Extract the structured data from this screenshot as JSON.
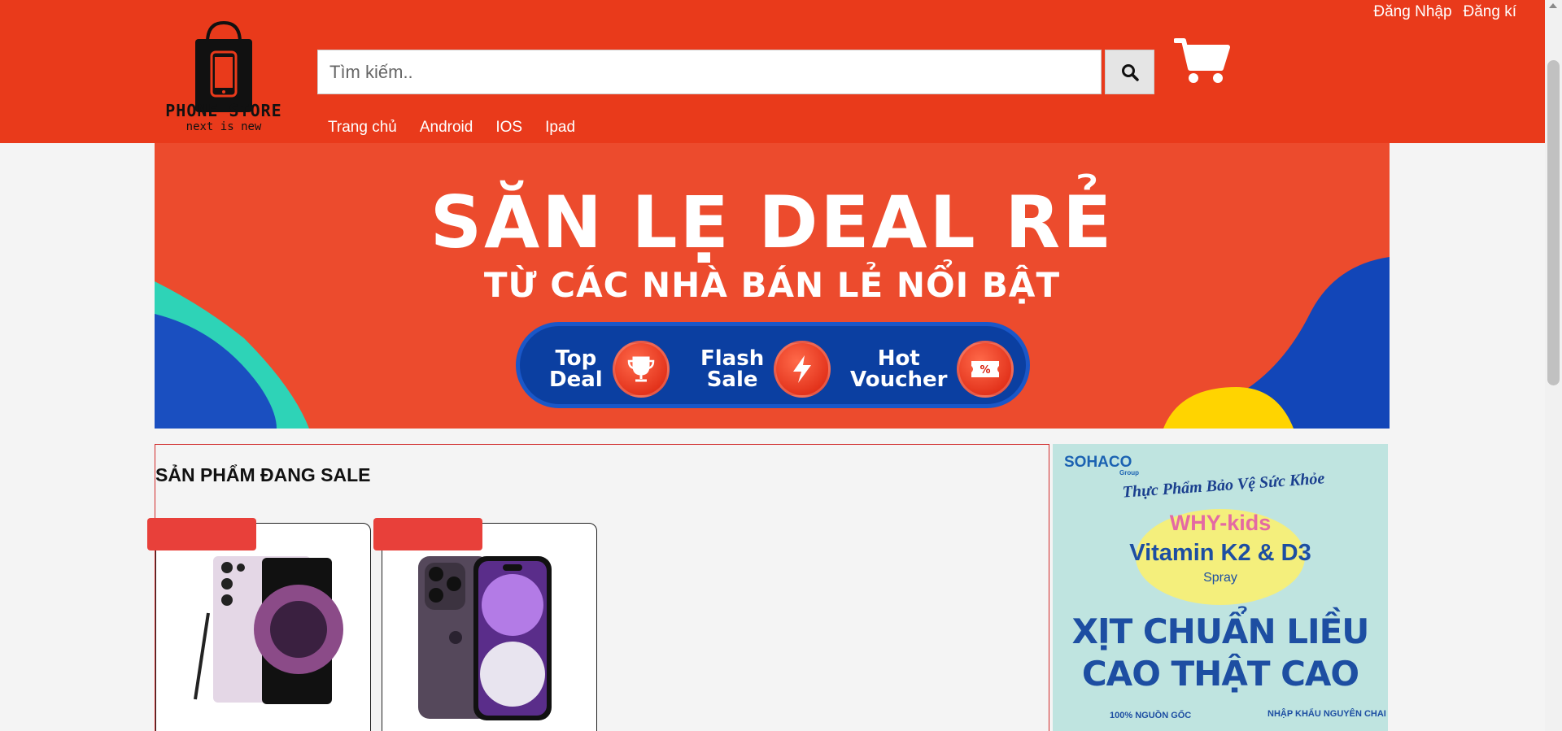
{
  "header": {
    "login_label": "Đăng Nhập",
    "register_label": "Đăng kí",
    "logo_text": "PHONE STORE",
    "logo_tagline": "next is new",
    "search_placeholder": "Tìm kiếm..",
    "nav": [
      {
        "label": "Trang chủ"
      },
      {
        "label": "Android"
      },
      {
        "label": "IOS"
      },
      {
        "label": "Ipad"
      }
    ],
    "icons": {
      "search": "search-icon",
      "cart": "cart-icon"
    }
  },
  "banner": {
    "title": "SĂN LẸ DEAL RẺ",
    "subtitle": "TỪ CÁC NHÀ BÁN LẺ NỔI BẬT",
    "pills": [
      {
        "line1": "Top",
        "line2": "Deal",
        "icon": "trophy-icon"
      },
      {
        "line1": "Flash",
        "line2": "Sale",
        "icon": "lightning-icon"
      },
      {
        "line1": "Hot",
        "line2": "Voucher",
        "icon": "voucher-icon"
      }
    ]
  },
  "sale": {
    "title": "SẢN PHẨM ĐANG SALE",
    "products": [
      {
        "image": "samsung-galaxy-phone"
      },
      {
        "image": "iphone-pro-purple"
      }
    ]
  },
  "ad": {
    "brand": "SOHACO",
    "brand_sub": "Group",
    "arc_text": "Thực Phẩm Bảo Vệ Sức Khỏe",
    "product": "WHY-kids",
    "vitamin": "Vitamin K2 & D3",
    "spray": "Spray",
    "headline1": "XỊT CHUẨN LIỀU",
    "headline2": "CAO THẬT CAO",
    "foot1": "100% NGUỒN GỐC",
    "foot2": "NHẬP KHẨU NGUYÊN CHAI"
  },
  "colors": {
    "header_bg": "#e93a1b",
    "banner_bg": "#ec4b2d",
    "pill_bg": "#0b3fa1",
    "badge": "#e8403a",
    "ad_bg": "#bfe4e0"
  }
}
